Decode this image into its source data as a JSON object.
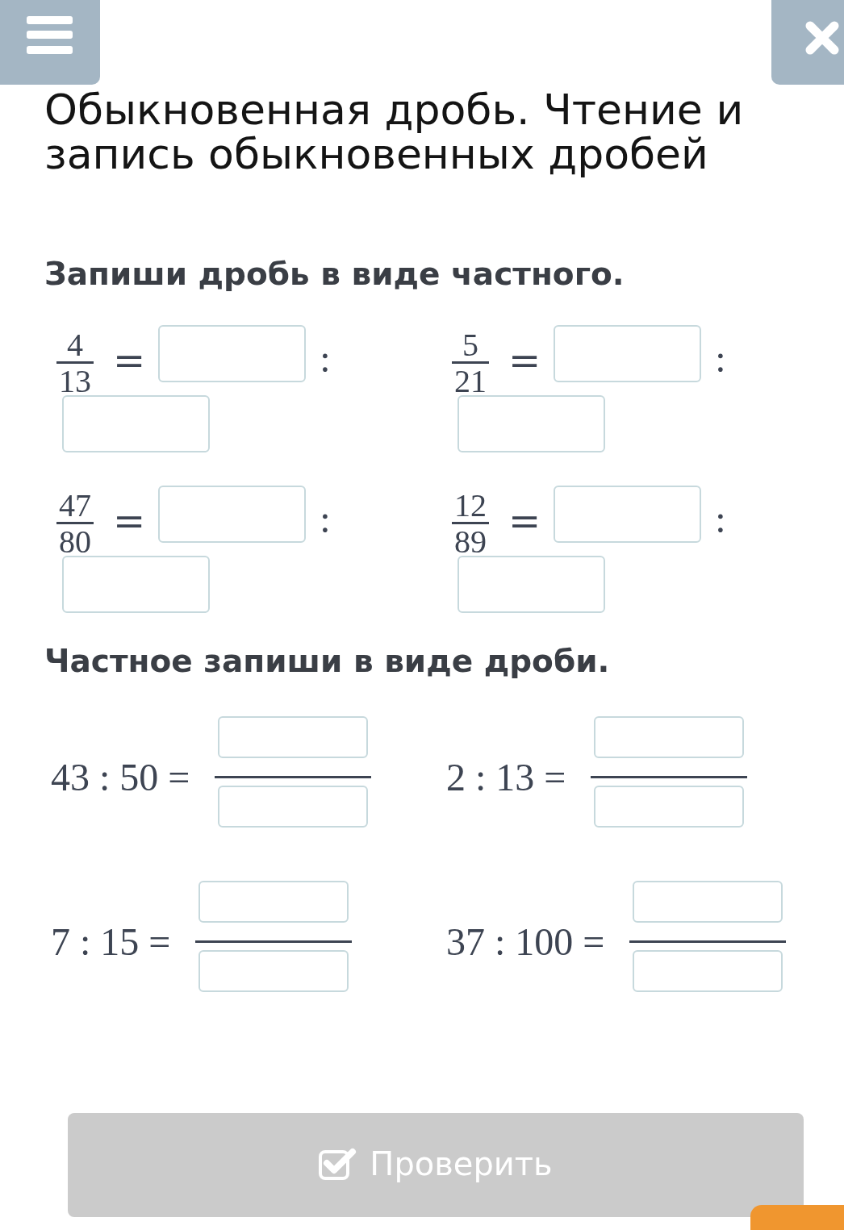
{
  "title": "Обыкновенная дробь. Чтение и запись обыкновенных дробей",
  "sections": [
    {
      "kind": "fraction_to_quotient",
      "heading": "Запиши дробь в виде частного.",
      "items": [
        {
          "numerator": "4",
          "denominator": "13",
          "equals": "=",
          "colon": ":"
        },
        {
          "numerator": "5",
          "denominator": "21",
          "equals": "=",
          "colon": ":"
        },
        {
          "numerator": "47",
          "denominator": "80",
          "equals": "=",
          "colon": ":"
        },
        {
          "numerator": "12",
          "denominator": "89",
          "equals": "=",
          "colon": ":"
        }
      ]
    },
    {
      "kind": "quotient_to_fraction",
      "heading": "Частное запиши в виде дроби.",
      "items": [
        {
          "expression": "43 : 50 ="
        },
        {
          "expression": "2 : 13 ="
        },
        {
          "expression": "7 : 15 ="
        },
        {
          "expression": "37 : 100 ="
        }
      ]
    }
  ],
  "check_button": {
    "label": "Проверить",
    "disabled": true
  }
}
